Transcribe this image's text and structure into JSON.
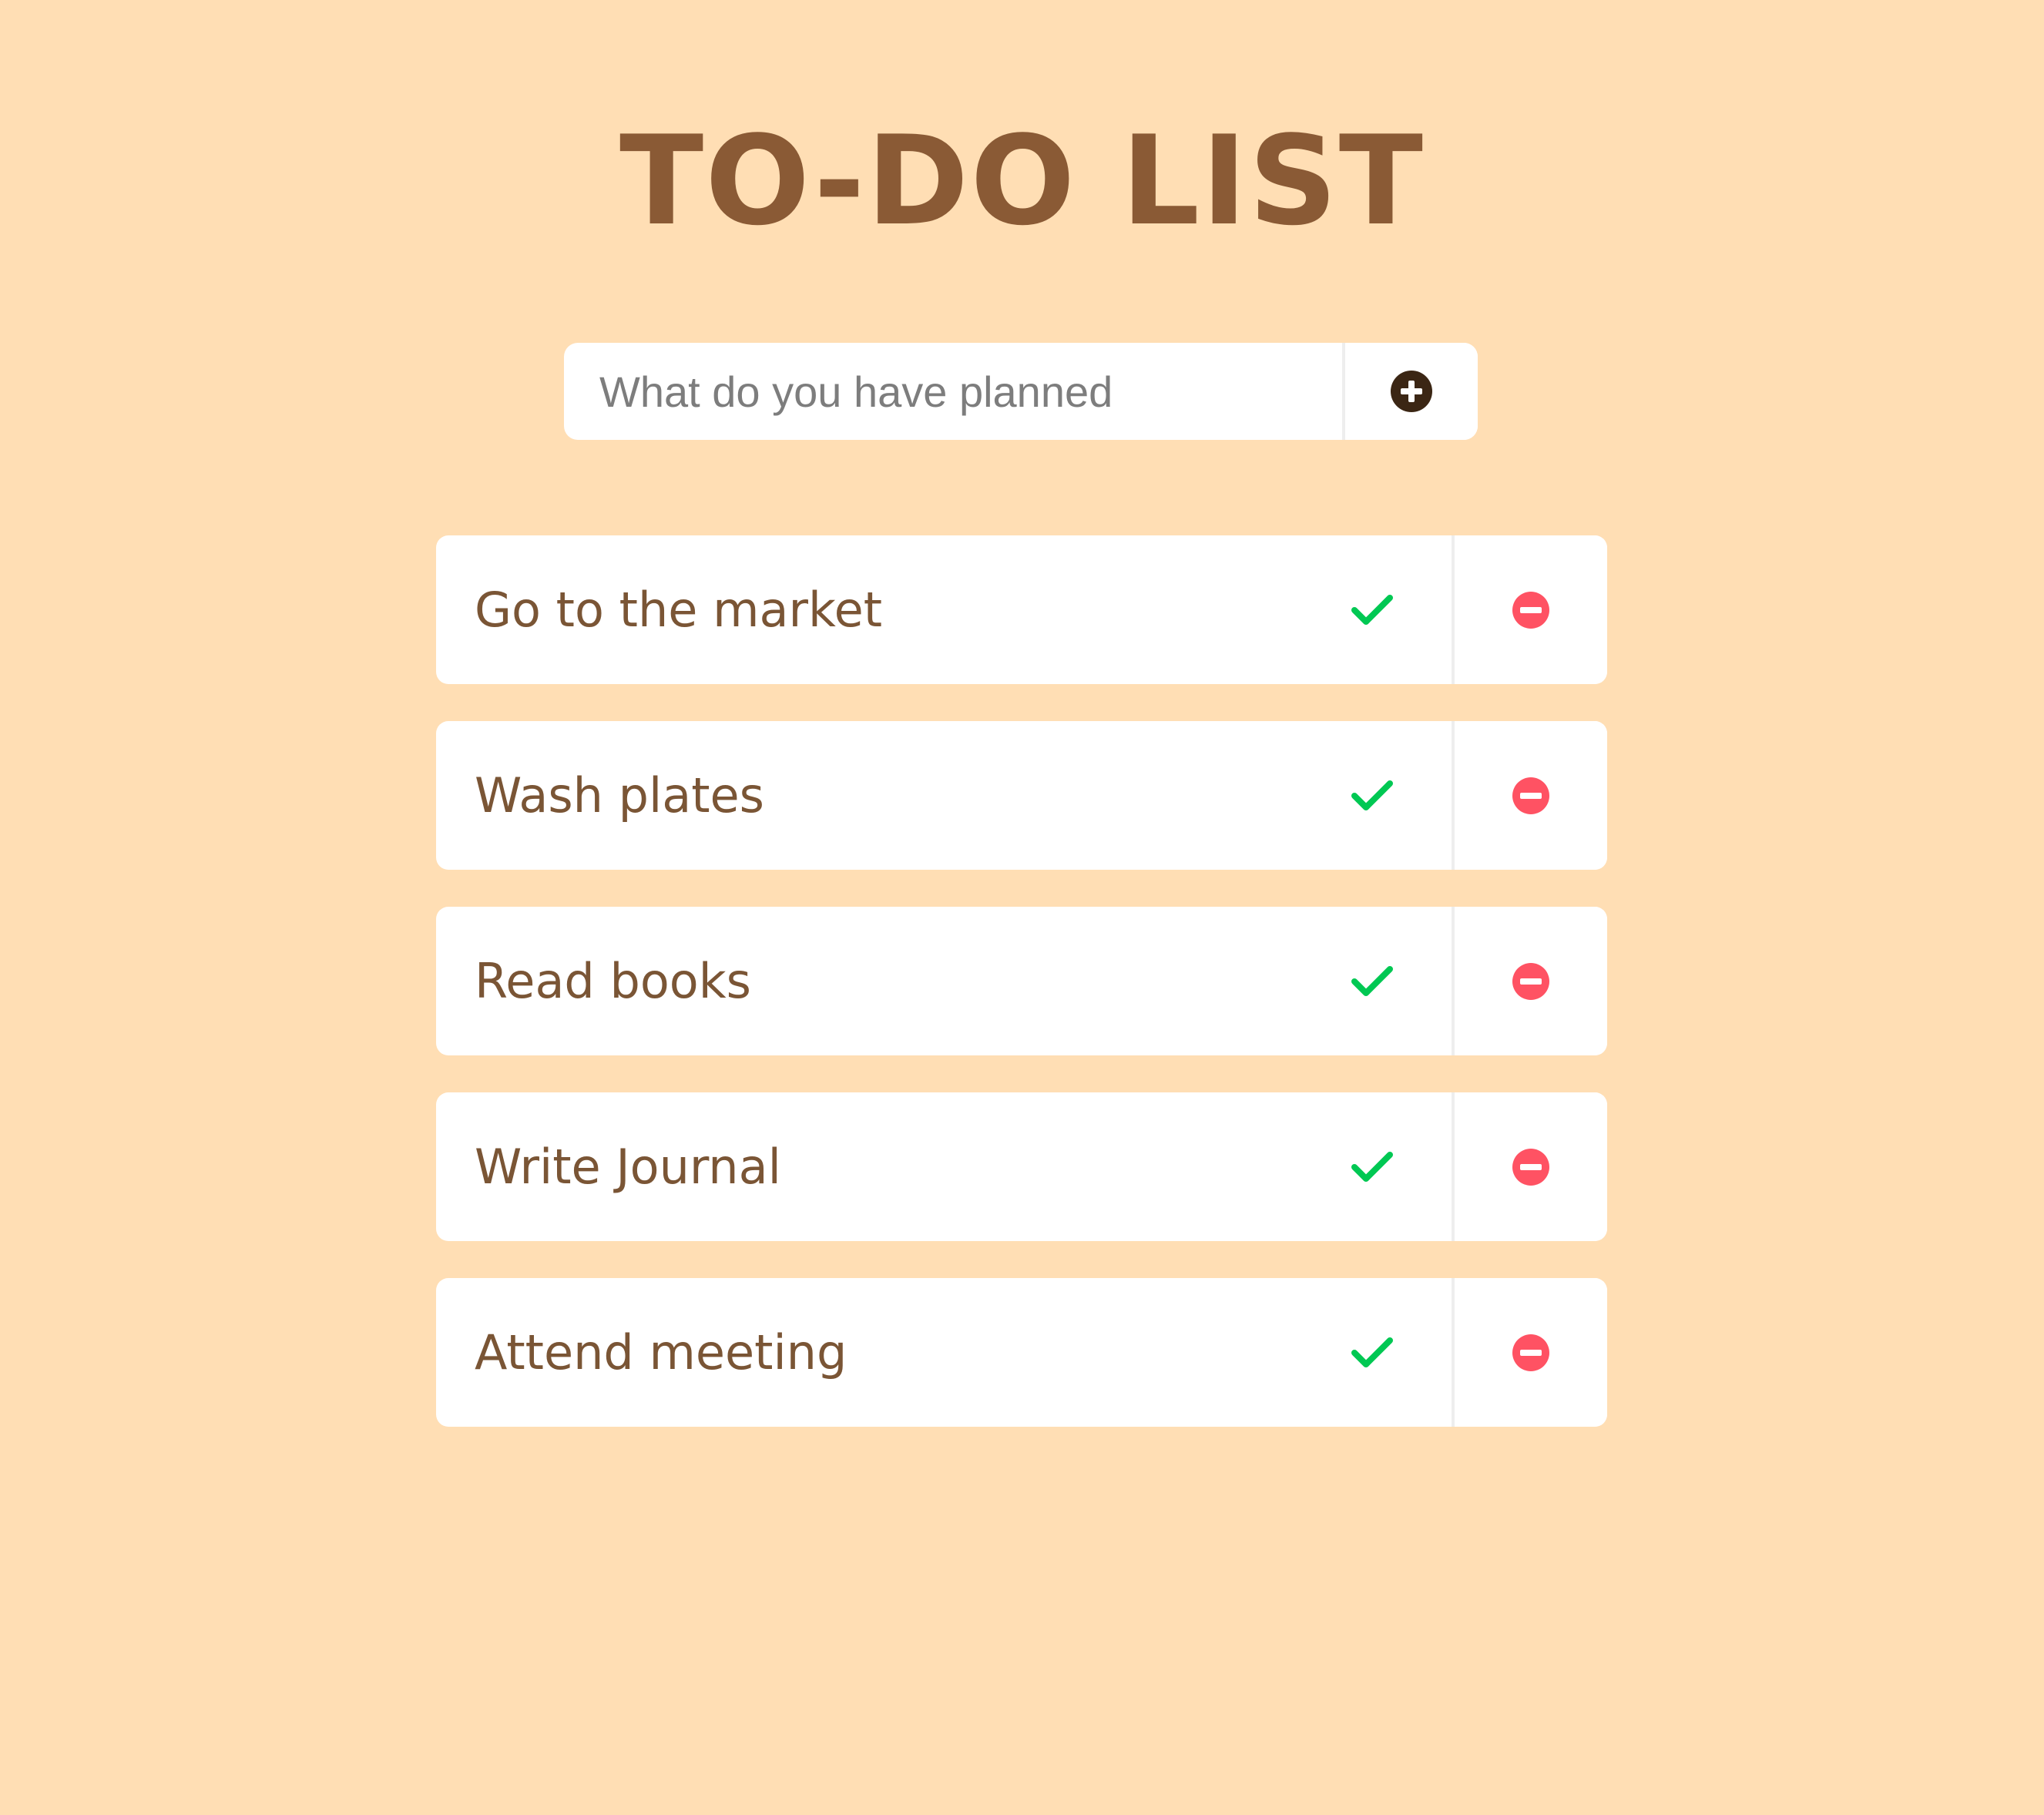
{
  "header": {
    "title": "TO-DO LIST"
  },
  "new_todo": {
    "placeholder": "What do you have planned",
    "value": "",
    "add_icon": "plus-circle-icon"
  },
  "todos": [
    {
      "text": "Go to the market"
    },
    {
      "text": "Wash plates"
    },
    {
      "text": "Read books"
    },
    {
      "text": "Write Journal"
    },
    {
      "text": "Attend meeting"
    }
  ],
  "icons": {
    "complete": "check-icon",
    "delete": "minus-circle-icon"
  },
  "colors": {
    "background": "#ffdeb4",
    "title": "#8a5a35",
    "todo_text": "#7a5535",
    "check": "#00c853",
    "delete": "#ff5263",
    "add_icon": "#3b2614"
  }
}
